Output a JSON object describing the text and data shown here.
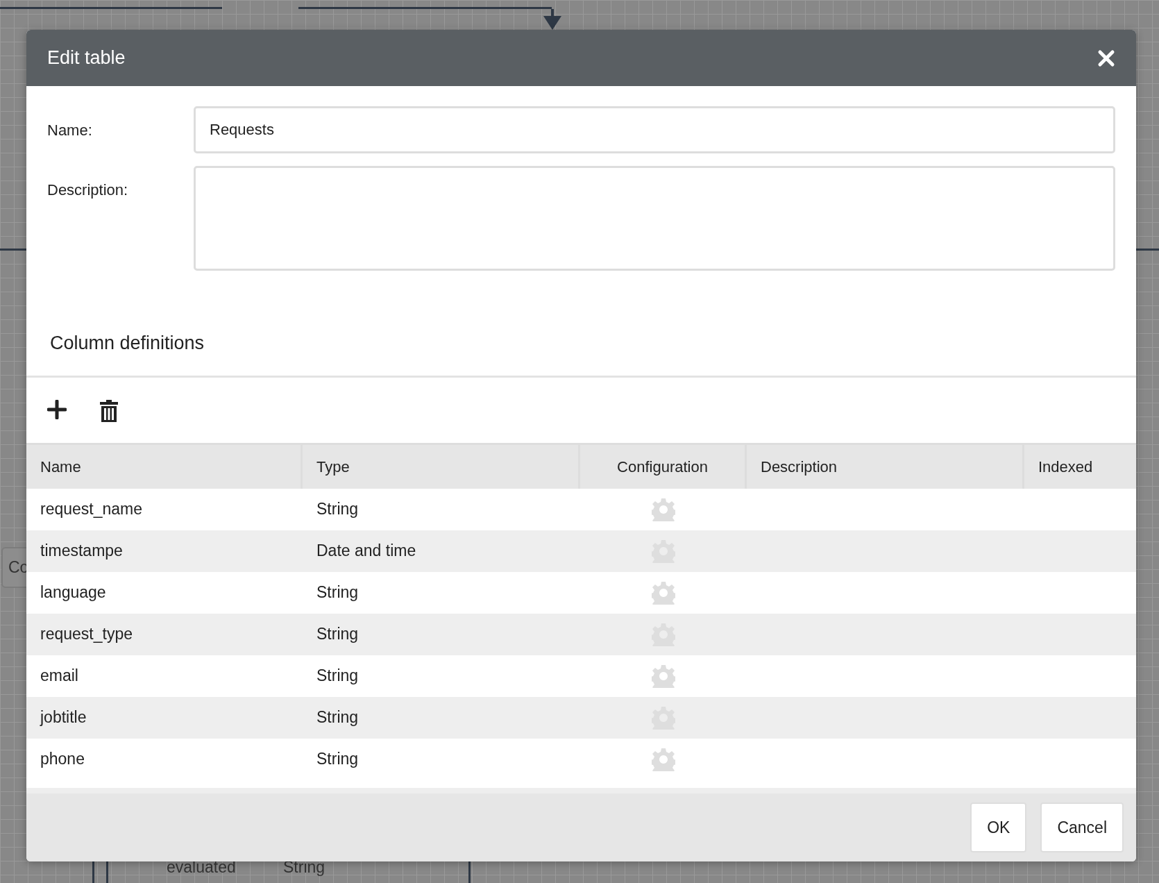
{
  "canvas": {
    "labels": [
      "Co",
      "evaluated",
      "String"
    ]
  },
  "dialog": {
    "title": "Edit table",
    "fields": [
      {
        "label": "Name:",
        "value": "Requests",
        "kind": "text"
      },
      {
        "label": "Description:",
        "kind": "textarea"
      }
    ],
    "section_title": "Column definitions",
    "table": {
      "columns": [
        "Name",
        "Type",
        "Configuration",
        "Description",
        "Indexed"
      ],
      "rows": [
        {
          "name": "request_name",
          "type": "String"
        },
        {
          "name": "timestampe",
          "type": "Date and time"
        },
        {
          "name": "language",
          "type": "String"
        },
        {
          "name": "request_type",
          "type": "String"
        },
        {
          "name": "email",
          "type": "String"
        },
        {
          "name": "jobtitle",
          "type": "String"
        },
        {
          "name": "phone",
          "type": "String"
        }
      ]
    },
    "buttons": [
      "OK",
      "Cancel"
    ]
  }
}
